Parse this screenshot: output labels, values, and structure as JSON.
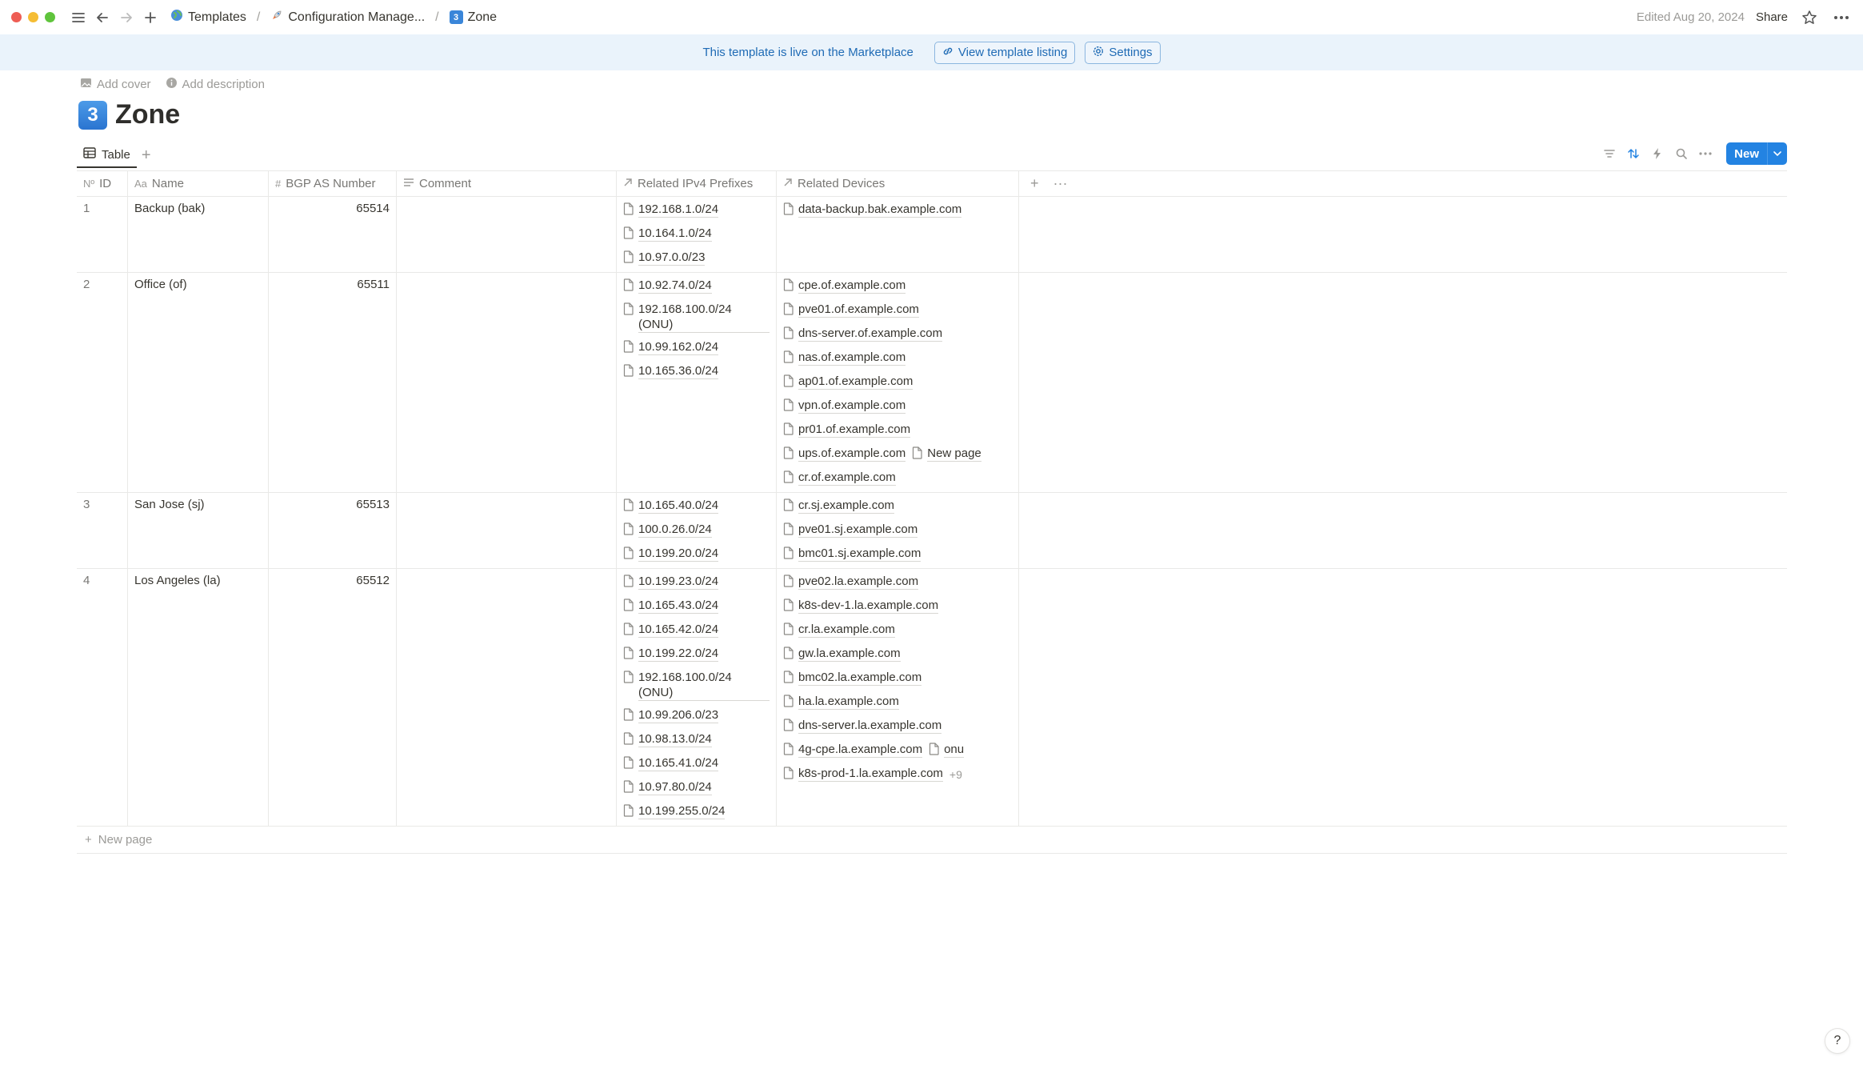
{
  "window": {
    "traffic_colors": [
      "#ee5d54",
      "#f5bd34",
      "#5fc43c"
    ]
  },
  "breadcrumb": [
    {
      "label": "Templates",
      "icon": "globe-icon"
    },
    {
      "label": "Configuration Manage...",
      "icon": "rocket-icon"
    },
    {
      "label": "Zone",
      "icon": "keycap-3-icon"
    }
  ],
  "topright": {
    "edited": "Edited Aug 20, 2024",
    "share": "Share"
  },
  "banner": {
    "text": "This template is live on the Marketplace",
    "listing_btn": "View template listing",
    "settings_btn": "Settings"
  },
  "page": {
    "add_cover": "Add cover",
    "add_description": "Add description",
    "title_emoji": "3",
    "title": "Zone"
  },
  "view": {
    "tab": "Table",
    "new_btn": "New"
  },
  "columns": {
    "id": "ID",
    "name": "Name",
    "bgp": "BGP AS Number",
    "comment": "Comment",
    "prefixes": "Related IPv4 Prefixes",
    "devices": "Related Devices"
  },
  "rows": [
    {
      "id": "1",
      "name": "Backup (bak)",
      "bgp": "65514",
      "comment": "",
      "prefixes": [
        "192.168.1.0/24",
        "10.164.1.0/24",
        "10.97.0.0/23"
      ],
      "devices": [
        [
          "data-backup.bak.example.com"
        ]
      ]
    },
    {
      "id": "2",
      "name": "Office (of)",
      "bgp": "65511",
      "comment": "",
      "prefixes": [
        "10.92.74.0/24",
        "192.168.100.0/24 (ONU)",
        "10.99.162.0/24",
        "10.165.36.0/24"
      ],
      "devices": [
        [
          "cpe.of.example.com"
        ],
        [
          "pve01.of.example.com"
        ],
        [
          "dns-server.of.example.com"
        ],
        [
          "nas.of.example.com"
        ],
        [
          "ap01.of.example.com"
        ],
        [
          "vpn.of.example.com"
        ],
        [
          "pr01.of.example.com"
        ],
        [
          "ups.of.example.com",
          "New page"
        ],
        [
          "cr.of.example.com"
        ]
      ]
    },
    {
      "id": "3",
      "name": "San Jose (sj)",
      "bgp": "65513",
      "comment": "",
      "prefixes": [
        "10.165.40.0/24",
        "100.0.26.0/24",
        "10.199.20.0/24"
      ],
      "devices": [
        [
          "cr.sj.example.com"
        ],
        [
          "pve01.sj.example.com"
        ],
        [
          "bmc01.sj.example.com"
        ]
      ]
    },
    {
      "id": "4",
      "name": "Los Angeles (la)",
      "bgp": "65512",
      "comment": "",
      "prefixes": [
        "10.199.23.0/24",
        "10.165.43.0/24",
        "10.165.42.0/24",
        "10.199.22.0/24",
        "192.168.100.0/24 (ONU)",
        "10.99.206.0/23",
        "10.98.13.0/24",
        "10.165.41.0/24",
        "10.97.80.0/24",
        "10.199.255.0/24"
      ],
      "devices": [
        [
          "pve02.la.example.com"
        ],
        [
          "k8s-dev-1.la.example.com"
        ],
        [
          "cr.la.example.com"
        ],
        [
          "gw.la.example.com"
        ],
        [
          "bmc02.la.example.com"
        ],
        [
          "ha.la.example.com"
        ],
        [
          "dns-server.la.example.com"
        ],
        [
          "4g-cpe.la.example.com",
          "onu"
        ],
        [
          "k8s-prod-1.la.example.com"
        ]
      ],
      "more": "+9"
    }
  ],
  "new_page": "New page",
  "help": "?"
}
